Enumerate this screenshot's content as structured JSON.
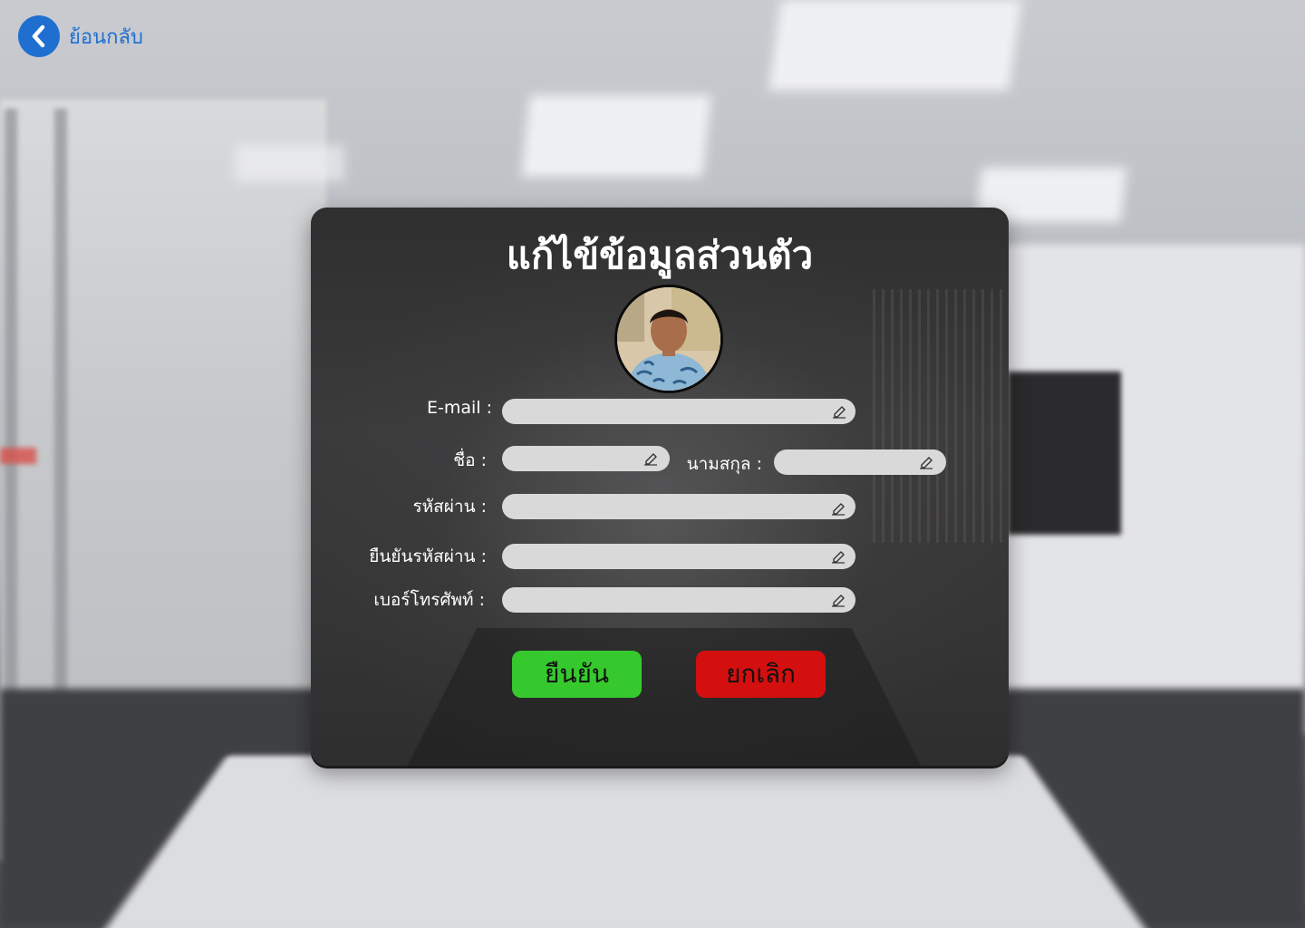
{
  "back": {
    "label": "ย้อนกลับ"
  },
  "form": {
    "title": "แก้ไข้ข้อมูลส่วนตัว",
    "fields": {
      "email": {
        "label": "E-mail :",
        "value": ""
      },
      "first_name": {
        "label": "ชื่อ :",
        "value": ""
      },
      "last_name": {
        "label": "นามสกุล :",
        "value": ""
      },
      "password": {
        "label": "รหัสผ่าน :",
        "value": ""
      },
      "confirm_password": {
        "label": "ยืนยันรหัสผ่าน :",
        "value": ""
      },
      "phone": {
        "label": "เบอร์โทรศัพท์ :",
        "value": ""
      }
    },
    "confirm_label": "ยืนยัน",
    "cancel_label": "ยกเลิก"
  },
  "icons": {
    "back": "chevron-left-icon",
    "edit": "pencil-icon"
  },
  "colors": {
    "back_accent": "#1f6fd1",
    "confirm": "#36c92d",
    "cancel": "#d40f0f",
    "input_bg": "#d9d9d9",
    "card_bg": "#3a3a3b"
  }
}
